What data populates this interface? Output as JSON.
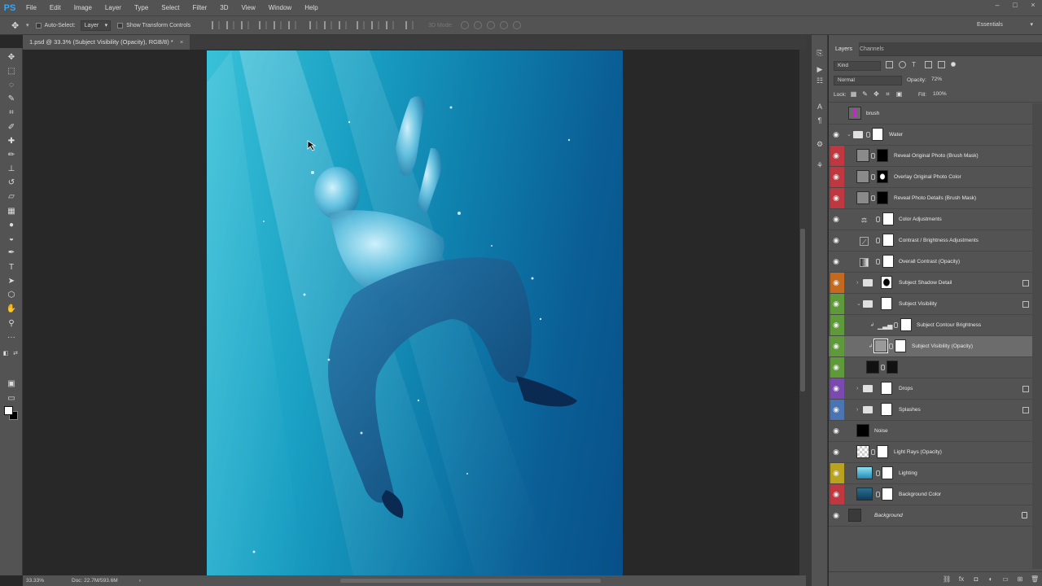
{
  "app": {
    "logo": "PS"
  },
  "menu": [
    "File",
    "Edit",
    "Image",
    "Layer",
    "Type",
    "Select",
    "Filter",
    "3D",
    "View",
    "Window",
    "Help"
  ],
  "window_controls": [
    "–",
    "□",
    "×"
  ],
  "options_bar": {
    "auto_select_label": "Auto-Select:",
    "auto_select_value": "Layer",
    "transform_label": "Show Transform Controls",
    "mode3d_label": "3D Mode:",
    "workspace": "Essentials"
  },
  "document": {
    "tab_title": "1.psd @ 33.3% (Subject Visibility (Opacity), RGB/8) *",
    "tab_close": "×"
  },
  "status": {
    "zoom": "33.33%",
    "doc_size": "Doc: 22.7M/593.6M",
    "arrow": "›"
  },
  "layers_panel": {
    "tabs": [
      "Layers",
      "Channels"
    ],
    "filter_kind": "Kind",
    "blend_mode": "Normal",
    "opacity_label": "Opacity:",
    "opacity_value": "72%",
    "lock_label": "Lock:",
    "fill_label": "Fill:",
    "fill_value": "100%",
    "layers": [
      {
        "name": "brush",
        "color": "none",
        "visible": false
      },
      {
        "name": "Water",
        "color": "none",
        "visible": true
      },
      {
        "name": "Reveal Original Photo (Brush Mask)",
        "color": "#c0373f",
        "visible": true
      },
      {
        "name": "Overlay Original Photo Color",
        "color": "#c0373f",
        "visible": true
      },
      {
        "name": "Reveal Photo Details (Brush Mask)",
        "color": "#c0373f",
        "visible": true
      },
      {
        "name": "Color Adjustments",
        "color": "none",
        "visible": true
      },
      {
        "name": "Contrast / Brightness Adjustments",
        "color": "none",
        "visible": true
      },
      {
        "name": "Overall Contrast (Opacity)",
        "color": "none",
        "visible": true
      },
      {
        "name": "Subject Shadow Detail",
        "color": "#c46a1e",
        "visible": true
      },
      {
        "name": "Subject Visibility",
        "color": "#5f9a3a",
        "visible": true
      },
      {
        "name": "Subject Contour Brightness",
        "color": "#5f9a3a",
        "visible": true
      },
      {
        "name": "Subject Visibility (Opacity)",
        "color": "#5f9a3a",
        "visible": true
      },
      {
        "name": "",
        "color": "#5f9a3a",
        "visible": true
      },
      {
        "name": "Drops",
        "color": "#7a4ab0",
        "visible": true
      },
      {
        "name": "Splashes",
        "color": "#4a74b4",
        "visible": true
      },
      {
        "name": "Noise",
        "color": "none",
        "visible": true
      },
      {
        "name": "Light Rays (Opacity)",
        "color": "none",
        "visible": true
      },
      {
        "name": "Lighting",
        "color": "#b9a21e",
        "visible": true
      },
      {
        "name": "Background Color",
        "color": "#c0373f",
        "visible": true
      },
      {
        "name": "Background",
        "color": "none",
        "visible": true
      }
    ]
  },
  "icons": {
    "eye": "◉",
    "expand_closed": "›",
    "expand_open": "⌄",
    "lock": "🔒"
  },
  "colors": {
    "accent": "#31a8ff",
    "panel": "#535353",
    "canvas_bg": "#282828"
  }
}
